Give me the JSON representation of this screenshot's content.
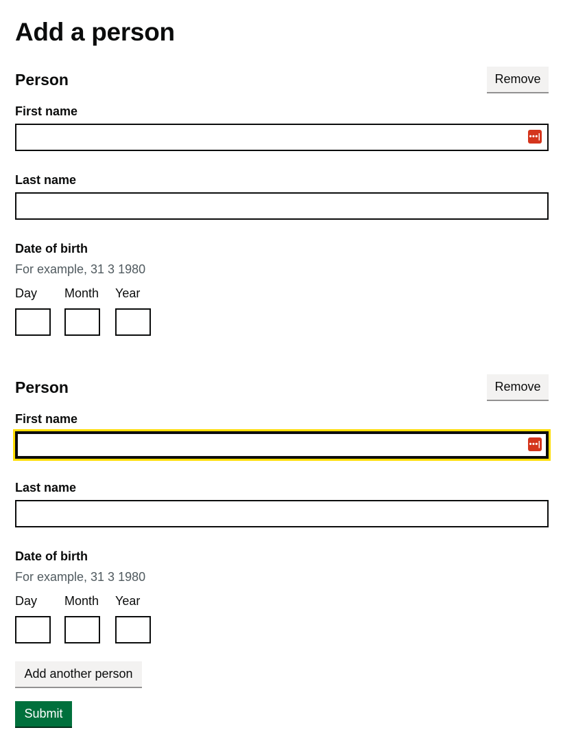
{
  "page": {
    "title": "Add a person"
  },
  "people": [
    {
      "heading": "Person",
      "remove_label": "Remove",
      "first_name_label": "First name",
      "first_name_value": "",
      "last_name_label": "Last name",
      "last_name_value": "",
      "dob_label": "Date of birth",
      "dob_hint": "For example, 31 3 1980",
      "day_label": "Day",
      "month_label": "Month",
      "year_label": "Year"
    },
    {
      "heading": "Person",
      "remove_label": "Remove",
      "first_name_label": "First name",
      "first_name_value": "",
      "first_name_focused": true,
      "last_name_label": "Last name",
      "last_name_value": "",
      "dob_label": "Date of birth",
      "dob_hint": "For example, 31 3 1980",
      "day_label": "Day",
      "month_label": "Month",
      "year_label": "Year"
    }
  ],
  "actions": {
    "add_another_label": "Add another person",
    "submit_label": "Submit"
  },
  "icons": {
    "password_manager": "password-manager-icon",
    "password_manager_glyph": "•••|"
  },
  "colors": {
    "text": "#0b0c0c",
    "hint": "#505a5f",
    "focus": "#ffdd00",
    "submit": "#00703c",
    "secondary_button": "#f3f2f1",
    "icon_red": "#d4351c"
  }
}
